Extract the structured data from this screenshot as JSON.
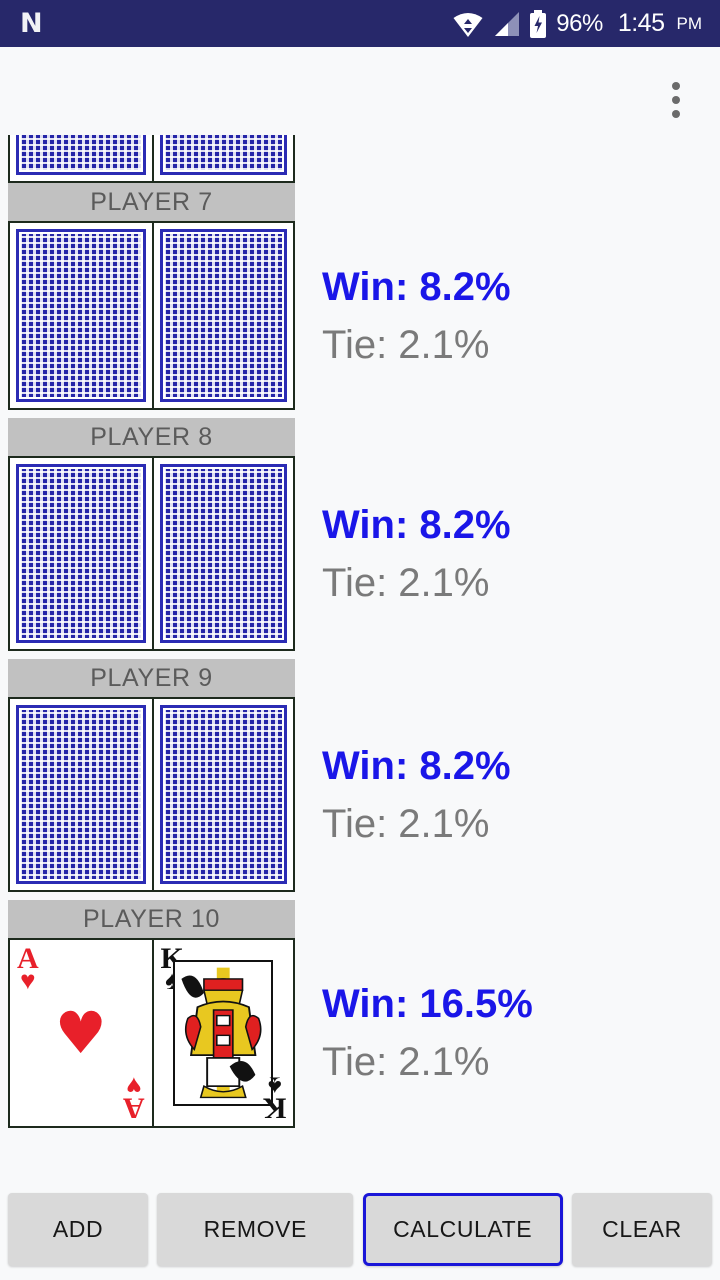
{
  "status_bar": {
    "logo": "android-n-logo",
    "icons": [
      "wifi-icon",
      "cell-signal-icon",
      "battery-charging-icon"
    ],
    "battery_percent": "96%",
    "time": "1:45",
    "am_pm": "PM",
    "background_color": "#27286a"
  },
  "app_bar": {
    "overflow_menu": "overflow-menu-icon"
  },
  "colors": {
    "win_text": "#1a16e8",
    "tie_text": "#7a7a7a",
    "player_header_bg": "#c1c1c1",
    "player_header_text": "#5b5b5b",
    "card_back_blue": "#2525a8",
    "focus_border": "#1a16d8",
    "button_bg": "#d9d9d9",
    "page_bg": "#f8f9fa"
  },
  "players": [
    {
      "label": "",
      "partial": true,
      "cards": [
        {
          "type": "back"
        },
        {
          "type": "back"
        }
      ],
      "win": "",
      "tie": ""
    },
    {
      "label": "PLAYER 7",
      "cards": [
        {
          "type": "back"
        },
        {
          "type": "back"
        }
      ],
      "win": "Win: 8.2%",
      "tie": "Tie: 2.1%"
    },
    {
      "label": "PLAYER 8",
      "cards": [
        {
          "type": "back"
        },
        {
          "type": "back"
        }
      ],
      "win": "Win: 8.2%",
      "tie": "Tie: 2.1%"
    },
    {
      "label": "PLAYER 9",
      "cards": [
        {
          "type": "back"
        },
        {
          "type": "back"
        }
      ],
      "win": "Win: 8.2%",
      "tie": "Tie: 2.1%"
    },
    {
      "label": "PLAYER 10",
      "cards": [
        {
          "type": "face",
          "rank": "A",
          "suit": "♥",
          "suit_name": "hearts",
          "color": "red"
        },
        {
          "type": "face",
          "rank": "K",
          "suit": "♠",
          "suit_name": "spades",
          "color": "black"
        }
      ],
      "win": "Win: 16.5%",
      "tie": "Tie: 2.1%"
    }
  ],
  "buttons": {
    "add": "ADD",
    "remove": "REMOVE",
    "calculate": "CALCULATE",
    "clear": "CLEAR"
  }
}
